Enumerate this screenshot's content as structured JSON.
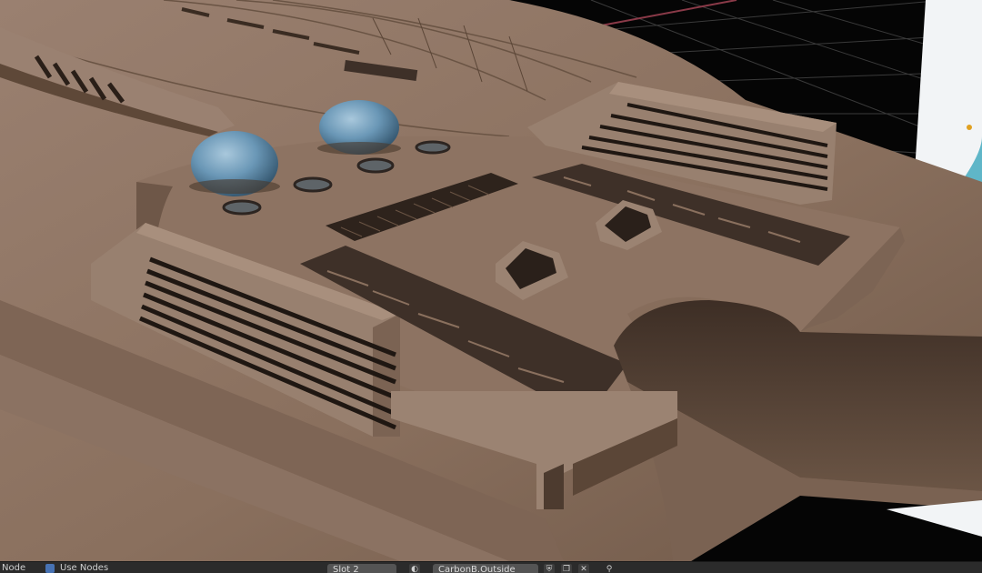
{
  "viewport": {
    "scene": "3d-render-of-spaceship-hull",
    "colors": {
      "background": "#050505",
      "grid_line": "#3a3a3a",
      "axis_x_line": "#8a3a48",
      "hull": "#8c7260",
      "hull_dark": "#5a4536",
      "hull_shadow": "#3d2e24",
      "dome": "#5f8fb0",
      "panel": "#3e3028"
    }
  },
  "bottom_bar": {
    "node_label": "Node",
    "use_nodes_label": "Use Nodes",
    "slot_label": "Slot 2",
    "material_name": "CarbonB.Outside"
  }
}
